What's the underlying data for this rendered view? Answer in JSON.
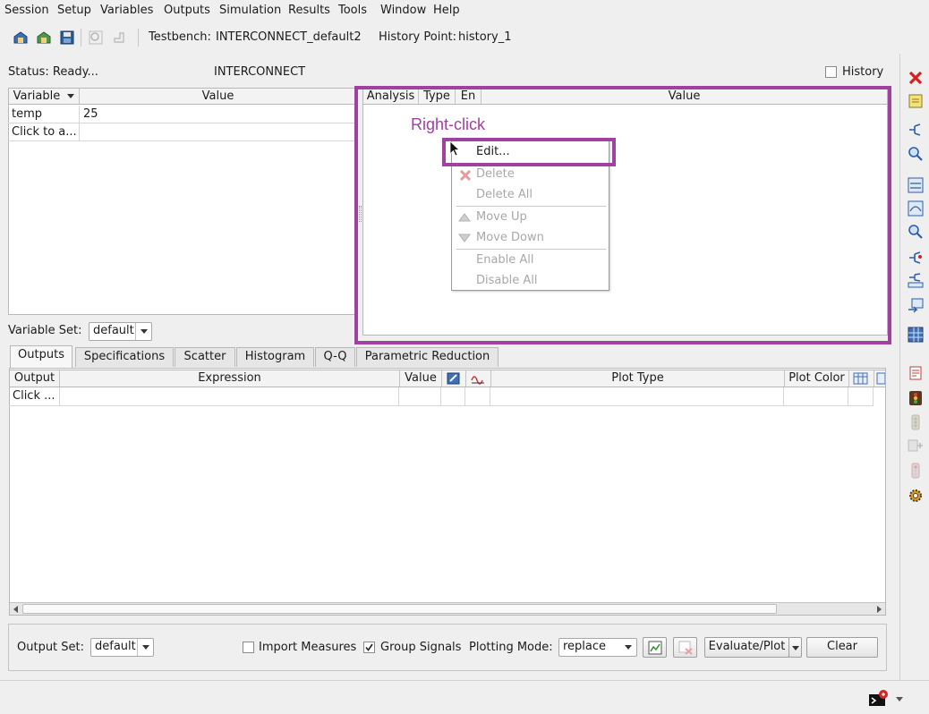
{
  "menubar": {
    "items": [
      "Session",
      "Setup",
      "Variables",
      "Outputs",
      "Simulation",
      "Results",
      "Tools",
      "Window",
      "Help"
    ]
  },
  "toolbar": {
    "testbench_label": "Testbench:",
    "testbench_value": "INTERCONNECT_default2",
    "history_label": "History Point:",
    "history_value": "history_1",
    "icons": [
      "open-session-icon",
      "load-state-icon",
      "save-state-icon",
      "zoom-icon",
      "back-icon"
    ]
  },
  "status": {
    "text": "Status: Ready...",
    "design": "INTERCONNECT",
    "history_checkbox": "History"
  },
  "variables_table": {
    "headers": [
      "Variable",
      "Value"
    ],
    "rows": [
      {
        "variable": "temp",
        "value": "25"
      },
      {
        "variable": "Click to a...",
        "value": ""
      }
    ]
  },
  "analysis_table": {
    "headers": [
      "Analysis",
      "Type",
      "En",
      "Value"
    ]
  },
  "annotation": {
    "right_click": "Right-click",
    "color": "#a040a0"
  },
  "context_menu": {
    "items": {
      "edit": "Edit...",
      "delete": "Delete",
      "delete_all": "Delete All",
      "move_up": "Move Up",
      "move_down": "Move Down",
      "enable_all": "Enable All",
      "disable_all": "Disable All"
    }
  },
  "variable_set": {
    "label": "Variable Set:",
    "value": "default"
  },
  "tabs": [
    "Outputs",
    "Specifications",
    "Scatter",
    "Histogram",
    "Q-Q",
    "Parametric Reduction"
  ],
  "outputs_table": {
    "headers": [
      "Output",
      "Expression",
      "Value",
      "",
      "",
      "Plot Type",
      "Plot Color",
      ""
    ],
    "rows": [
      {
        "output": "Click ...",
        "expression": "",
        "value": ""
      }
    ]
  },
  "bottom": {
    "output_set_label": "Output Set:",
    "output_set_value": "default",
    "import_measures": "Import Measures",
    "group_signals": "Group Signals",
    "plotting_mode_label": "Plotting Mode:",
    "plotting_mode_value": "replace",
    "evaluate_plot": "Evaluate/Plot",
    "clear": "Clear"
  },
  "right_toolbar_icons": [
    "close-icon",
    "note-icon",
    "schematic-icon",
    "zoom-icon",
    "tran-icon",
    "sweep-icon",
    "zoom-icon",
    "probe-icon",
    "model-icon",
    "annotate-icon",
    "grid-icon",
    "results-icon",
    "signal-icon",
    "netlist-icon",
    "step-icon",
    "stop-icon",
    "gear-icon"
  ]
}
